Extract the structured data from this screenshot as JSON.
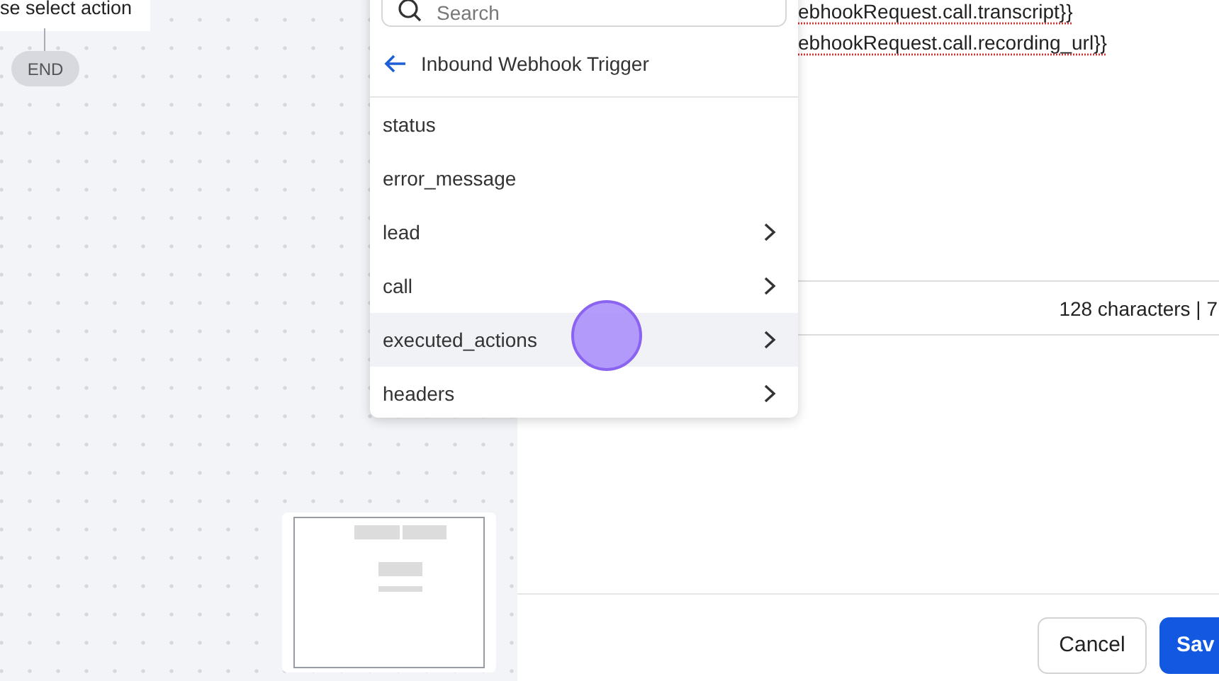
{
  "canvas": {
    "action_node": "se select action",
    "end_node": "END"
  },
  "dropdown": {
    "search": {
      "placeholder": "Search"
    },
    "back_title": "Inbound Webhook Trigger",
    "items": [
      {
        "label": "status",
        "has_children": false,
        "hovered": false
      },
      {
        "label": "error_message",
        "has_children": false,
        "hovered": false
      },
      {
        "label": "lead",
        "has_children": true,
        "hovered": false
      },
      {
        "label": "call",
        "has_children": true,
        "hovered": false
      },
      {
        "label": "executed_actions",
        "has_children": true,
        "hovered": true
      },
      {
        "label": "headers",
        "has_children": true,
        "hovered": false
      }
    ]
  },
  "editor": {
    "lines": [
      "ebhookRequest.call.transcript}}",
      "ebhookRequest.call.recording_url}}"
    ],
    "stats": "128 characters | 7"
  },
  "buttons": [
    {
      "label": "Cancel",
      "kind": "secondary"
    },
    {
      "label": "Sav",
      "kind": "primary"
    }
  ]
}
